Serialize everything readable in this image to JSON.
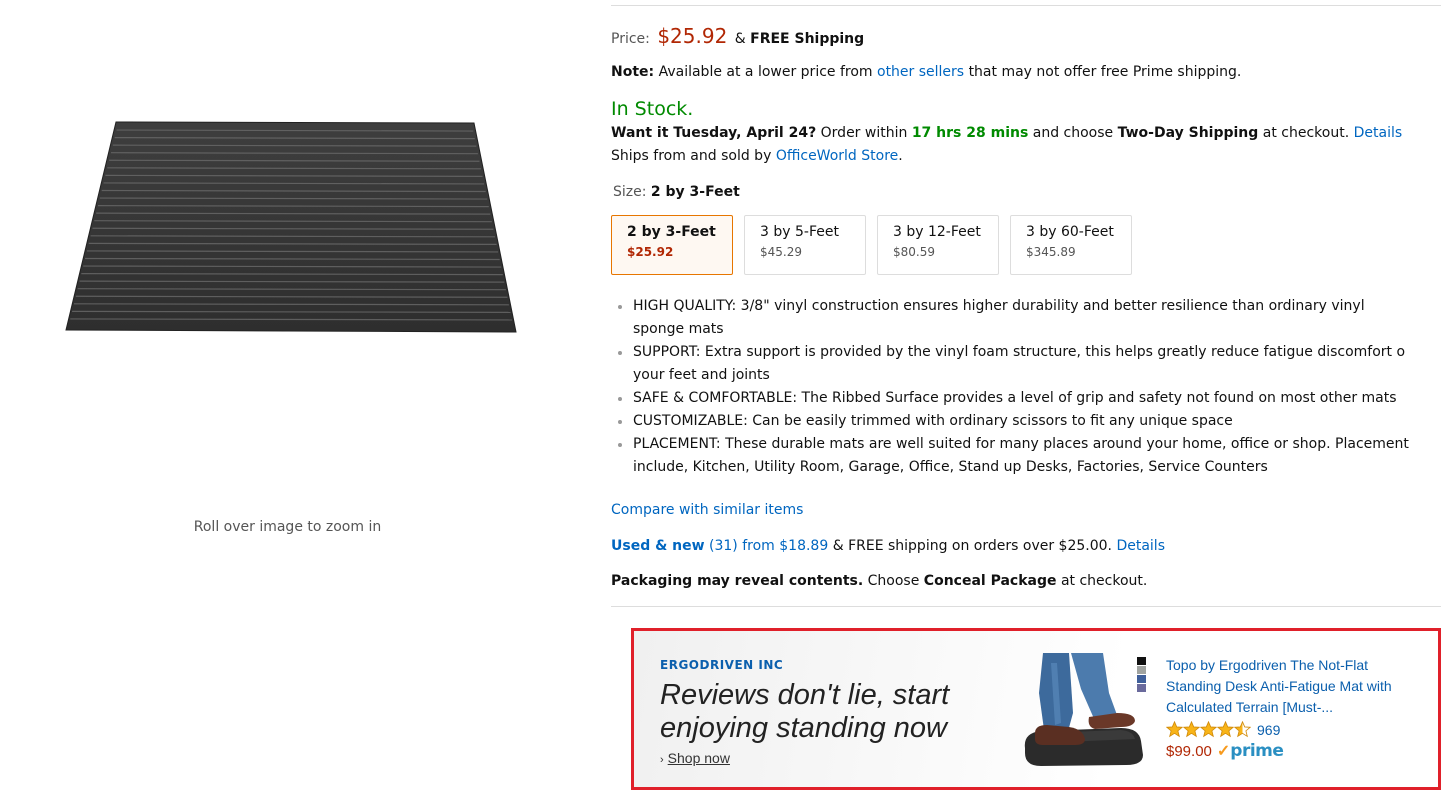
{
  "image_panel": {
    "zoom_hint": "Roll over image to zoom in"
  },
  "price": {
    "label": "Price:",
    "amount": "$25.92",
    "amp": "&",
    "shipping": "FREE Shipping"
  },
  "note": {
    "label": "Note:",
    "text_before": "Available at a lower price from",
    "link": "other sellers",
    "text_after": "that may not offer free Prime shipping."
  },
  "stock": {
    "status": "In Stock.",
    "status_color": "#008a00"
  },
  "delivery": {
    "question": "Want it Tuesday, April 24?",
    "order_within": "Order within",
    "countdown": "17 hrs 28 mins",
    "and_choose": "and choose",
    "shipping_method": "Two-Day Shipping",
    "at_checkout": "at checkout.",
    "details_link": "Details"
  },
  "ships": {
    "text": "Ships from and sold by",
    "seller": "OfficeWorld Store",
    "period": "."
  },
  "size": {
    "label": "Size:",
    "selected": "2 by 3-Feet",
    "options": [
      {
        "name": "2 by 3-Feet",
        "price": "$25.92",
        "selected": true
      },
      {
        "name": "3 by 5-Feet",
        "price": "$45.29",
        "selected": false
      },
      {
        "name": "3 by 12-Feet",
        "price": "$80.59",
        "selected": false
      },
      {
        "name": "3 by 60-Feet",
        "price": "$345.89",
        "selected": false
      }
    ]
  },
  "bullets": [
    {
      "line1": "HIGH QUALITY: 3/8\" vinyl construction ensures higher durability and better resilience than ordinary vinyl",
      "line2": "sponge mats"
    },
    {
      "line1": "SUPPORT: Extra support is provided by the vinyl foam structure, this helps greatly reduce fatigue discomfort o",
      "line2": "your feet and joints"
    },
    {
      "line1": "SAFE & COMFORTABLE: The Ribbed Surface provides a level of grip and safety not found on most other mats",
      "line2": ""
    },
    {
      "line1": "CUSTOMIZABLE: Can be easily trimmed with ordinary scissors to fit any unique space",
      "line2": ""
    },
    {
      "line1": "PLACEMENT: These durable mats are well suited for many places around your home, office or shop. Placement",
      "line2": "include, Kitchen, Utility Room, Garage, Office, Stand up Desks, Factories, Service Counters"
    }
  ],
  "compare_link": "Compare with similar items",
  "used_new": {
    "link_bold": "Used & new",
    "link_rest": "(31) from $18.89",
    "text": "& FREE shipping on orders over $25.00.",
    "details_link": "Details"
  },
  "packaging": {
    "bold": "Packaging may reveal contents.",
    "choose": "Choose",
    "option": "Conceal Package",
    "at_checkout": "at checkout."
  },
  "sponsored_ad": {
    "brand": "ERGODRIVEN INC",
    "headline": "Reviews don't lie, start enjoying standing now",
    "cta": "Shop now",
    "product_title": "Topo by Ergodriven The Not-Flat Standing Desk Anti-Fatigue Mat with Calculated Terrain [Must-...",
    "rating": 4.5,
    "rating_max": 5,
    "review_count": "969",
    "price": "$99.00",
    "prime_label": "prime",
    "swatch_colors": [
      "#111111",
      "#a0a3a0",
      "#3f5f9a",
      "#6a6a9c"
    ],
    "border_color": "#e0202a"
  }
}
